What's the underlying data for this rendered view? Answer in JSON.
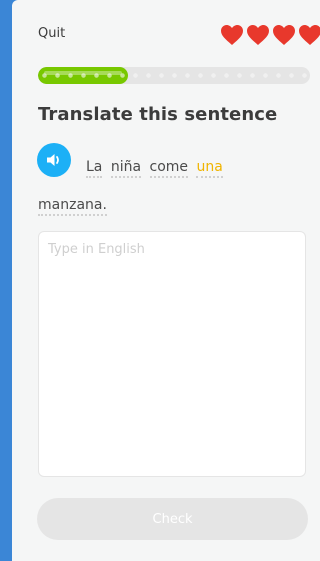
{
  "header": {
    "quit_label": "Quit",
    "hearts": {
      "count": 4,
      "icon": "heart-icon",
      "color": "#e8382c"
    }
  },
  "progress": {
    "completed": 0.33,
    "color": "#78c800",
    "track_color": "#e5e5e5"
  },
  "prompt": {
    "title": "Translate this sentence",
    "speaker_icon": "speaker-icon",
    "words": [
      {
        "text": "La",
        "new": false
      },
      {
        "text": "niña",
        "new": false
      },
      {
        "text": "come",
        "new": false
      },
      {
        "text": "una",
        "new": true
      },
      {
        "text": "manzana.",
        "new": false
      }
    ]
  },
  "answer": {
    "placeholder": "Type in English",
    "value": ""
  },
  "footer": {
    "check_label": "Check",
    "enabled": false
  },
  "colors": {
    "accent_blue": "#1cb0f6",
    "new_word": "#f0b400",
    "background": "#3b86d6"
  }
}
